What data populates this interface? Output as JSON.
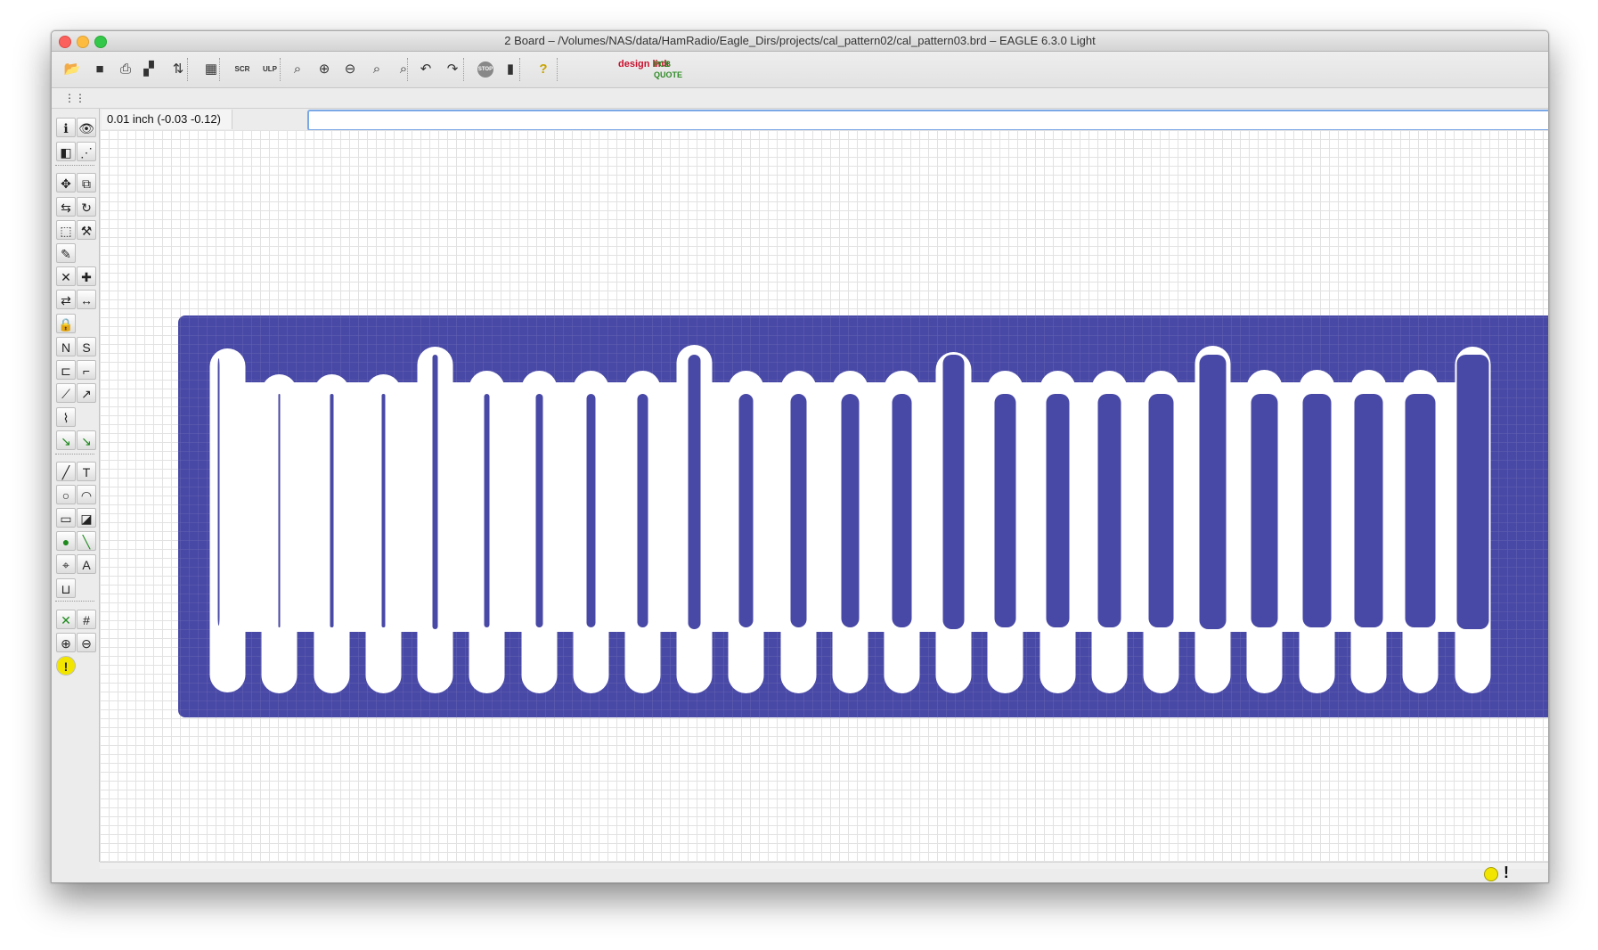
{
  "window": {
    "title": "2 Board – /Volumes/NAS/data/HamRadio/Eagle_Dirs/projects/cal_pattern02/cal_pattern03.brd – EAGLE 6.3.0 Light"
  },
  "toolbar": {
    "buttons": [
      {
        "name": "open-icon",
        "glyph": "📂"
      },
      {
        "name": "save-icon",
        "glyph": "■"
      },
      {
        "name": "print-icon",
        "glyph": "⎙"
      },
      {
        "name": "cam-icon",
        "glyph": "▞"
      },
      {
        "name": "switch-schematic-icon",
        "glyph": "⇅"
      },
      {
        "name": "library-icon",
        "glyph": "▦"
      },
      {
        "name": "script-icon",
        "label": "SCR"
      },
      {
        "name": "ulp-icon",
        "label": "ULP"
      },
      {
        "name": "zoom-fit-icon",
        "glyph": "⌕"
      },
      {
        "name": "zoom-in-icon",
        "glyph": "⊕"
      },
      {
        "name": "zoom-out-icon",
        "glyph": "⊖"
      },
      {
        "name": "zoom-redraw-icon",
        "glyph": "⌕"
      },
      {
        "name": "zoom-select-icon",
        "glyph": "⌕"
      },
      {
        "name": "undo-icon",
        "glyph": "↶"
      },
      {
        "name": "redo-icon",
        "glyph": "↷"
      },
      {
        "name": "stop-icon",
        "label": "STOP"
      },
      {
        "name": "go-icon",
        "glyph": "▮"
      },
      {
        "name": "help-icon",
        "glyph": "?"
      }
    ],
    "design_link": "design link",
    "pcb_quote": "PCB QUOTE"
  },
  "command": {
    "coord": "0.01 inch (-0.03 -0.12)",
    "value": "",
    "placeholder": ""
  },
  "colors": {
    "board": "#4848a6",
    "trace": "#ffffff",
    "grid": "#e2e2e2",
    "status_dot": "#f2e600"
  },
  "left_tools": [
    {
      "name": "info-icon",
      "glyph": "ℹ"
    },
    {
      "name": "show-icon",
      "glyph": "👁"
    },
    {
      "name": "layers-icon",
      "glyph": "◧"
    },
    {
      "name": "mark-icon",
      "glyph": "⋰"
    },
    {
      "name": "move-icon",
      "glyph": "✥"
    },
    {
      "name": "copy-icon",
      "glyph": "⧉"
    },
    {
      "name": "mirror-icon",
      "glyph": "⇆"
    },
    {
      "name": "rotate-icon",
      "glyph": "↻"
    },
    {
      "name": "group-icon",
      "glyph": "⬚"
    },
    {
      "name": "change-icon",
      "glyph": "⚒"
    },
    {
      "name": "paste-icon",
      "glyph": "✎"
    },
    {
      "name": "delete-icon",
      "glyph": "✕"
    },
    {
      "name": "add-icon",
      "glyph": "✚"
    },
    {
      "name": "replace-icon",
      "glyph": "⇄"
    },
    {
      "name": "value-icon",
      "glyph": "↔"
    },
    {
      "name": "lock-icon",
      "glyph": "🔒"
    },
    {
      "name": "name-icon",
      "glyph": "N"
    },
    {
      "name": "smash-icon",
      "glyph": "S"
    },
    {
      "name": "split-icon",
      "glyph": "⊏"
    },
    {
      "name": "miter-icon",
      "glyph": "⌐"
    },
    {
      "name": "optimize-icon",
      "glyph": "⟋"
    },
    {
      "name": "route-icon",
      "glyph": "↗"
    },
    {
      "name": "meander-icon",
      "glyph": "⌇"
    },
    {
      "name": "ripup-icon",
      "glyph": "↘"
    },
    {
      "name": "signal-icon",
      "glyph": "↘"
    },
    {
      "name": "wire-icon",
      "glyph": "╱"
    },
    {
      "name": "text-icon",
      "glyph": "T"
    },
    {
      "name": "circle-icon",
      "glyph": "○"
    },
    {
      "name": "arc-icon",
      "glyph": "◠"
    },
    {
      "name": "rect-icon",
      "glyph": "▭"
    },
    {
      "name": "polygon-icon",
      "glyph": "◪"
    },
    {
      "name": "via-icon",
      "glyph": "●"
    },
    {
      "name": "airwire-icon",
      "glyph": "╲"
    },
    {
      "name": "hole-icon",
      "glyph": "⌖"
    },
    {
      "name": "attribute-icon",
      "glyph": "A"
    },
    {
      "name": "dimension-icon",
      "glyph": "⊔"
    },
    {
      "name": "ratsnest-icon",
      "glyph": "✕"
    },
    {
      "name": "auto-icon",
      "glyph": "#"
    },
    {
      "name": "erc-icon",
      "glyph": "⊕"
    },
    {
      "name": "drc-icon",
      "glyph": "⊖"
    },
    {
      "name": "errors-icon",
      "glyph": "!"
    }
  ],
  "status": {
    "indicator": "yellow",
    "alert": "!"
  }
}
